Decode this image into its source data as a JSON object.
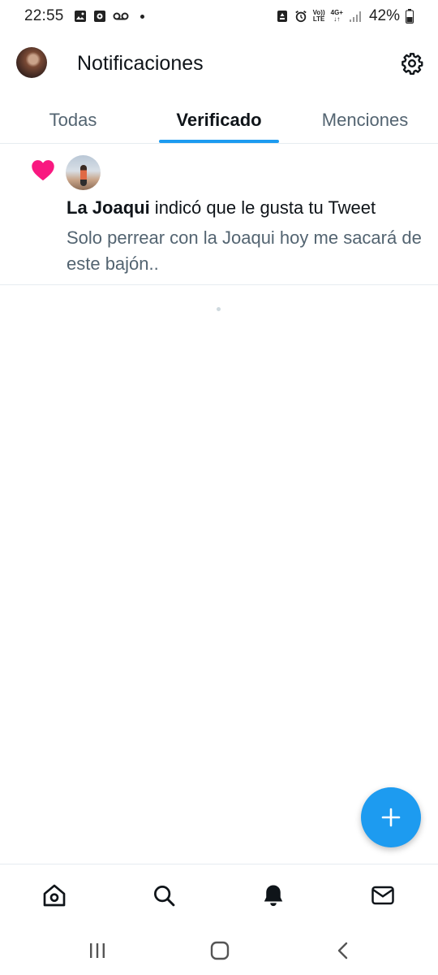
{
  "status_bar": {
    "time": "22:55",
    "battery": "42%",
    "network": "4G+",
    "volte_top": "Vo))",
    "volte_bottom": "LTE",
    "icons": [
      "image-icon",
      "app-icon",
      "voicemail-icon",
      "recycle-icon",
      "alarm-icon",
      "signal-icon",
      "battery-icon"
    ]
  },
  "header": {
    "title": "Notificaciones",
    "settings_icon": "gear-icon"
  },
  "tabs": [
    {
      "label": "Todas",
      "active": false
    },
    {
      "label": "Verificado",
      "active": true
    },
    {
      "label": "Menciones",
      "active": false
    }
  ],
  "notifications": [
    {
      "type_icon": "heart-icon",
      "user": "La Joaqui",
      "action": " indicó que le gusta tu Tweet",
      "tweet": "Solo perrear con la Joaqui hoy me sacará de este bajón.."
    }
  ],
  "fab": {
    "icon": "plus-icon"
  },
  "bottom_nav": [
    "home-icon",
    "search-icon",
    "bell-icon",
    "mail-icon"
  ],
  "system_nav": [
    "recents-icon",
    "home-circle-icon",
    "back-icon"
  ],
  "colors": {
    "accent": "#1d9bf0",
    "heart": "#f91880",
    "secondary_text": "#536471"
  }
}
